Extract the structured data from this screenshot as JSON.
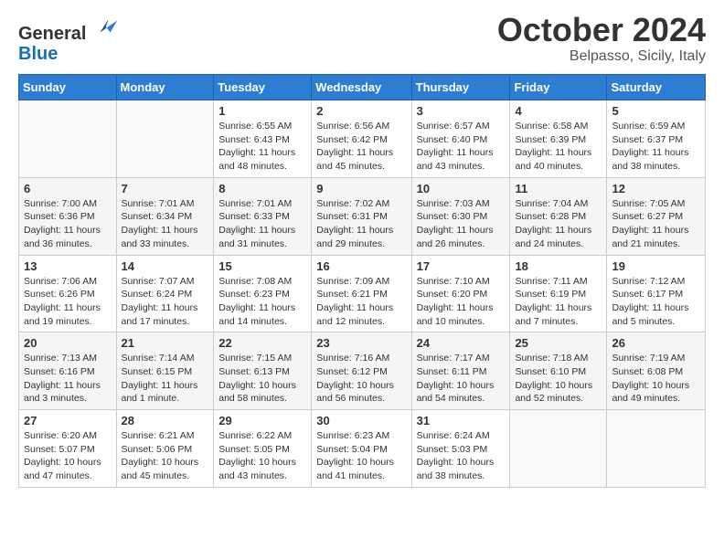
{
  "header": {
    "logo_line1": "General",
    "logo_line2": "Blue",
    "month": "October 2024",
    "location": "Belpasso, Sicily, Italy"
  },
  "days_of_week": [
    "Sunday",
    "Monday",
    "Tuesday",
    "Wednesday",
    "Thursday",
    "Friday",
    "Saturday"
  ],
  "weeks": [
    [
      {
        "day": "",
        "info": ""
      },
      {
        "day": "",
        "info": ""
      },
      {
        "day": "1",
        "info": "Sunrise: 6:55 AM\nSunset: 6:43 PM\nDaylight: 11 hours and 48 minutes."
      },
      {
        "day": "2",
        "info": "Sunrise: 6:56 AM\nSunset: 6:42 PM\nDaylight: 11 hours and 45 minutes."
      },
      {
        "day": "3",
        "info": "Sunrise: 6:57 AM\nSunset: 6:40 PM\nDaylight: 11 hours and 43 minutes."
      },
      {
        "day": "4",
        "info": "Sunrise: 6:58 AM\nSunset: 6:39 PM\nDaylight: 11 hours and 40 minutes."
      },
      {
        "day": "5",
        "info": "Sunrise: 6:59 AM\nSunset: 6:37 PM\nDaylight: 11 hours and 38 minutes."
      }
    ],
    [
      {
        "day": "6",
        "info": "Sunrise: 7:00 AM\nSunset: 6:36 PM\nDaylight: 11 hours and 36 minutes."
      },
      {
        "day": "7",
        "info": "Sunrise: 7:01 AM\nSunset: 6:34 PM\nDaylight: 11 hours and 33 minutes."
      },
      {
        "day": "8",
        "info": "Sunrise: 7:01 AM\nSunset: 6:33 PM\nDaylight: 11 hours and 31 minutes."
      },
      {
        "day": "9",
        "info": "Sunrise: 7:02 AM\nSunset: 6:31 PM\nDaylight: 11 hours and 29 minutes."
      },
      {
        "day": "10",
        "info": "Sunrise: 7:03 AM\nSunset: 6:30 PM\nDaylight: 11 hours and 26 minutes."
      },
      {
        "day": "11",
        "info": "Sunrise: 7:04 AM\nSunset: 6:28 PM\nDaylight: 11 hours and 24 minutes."
      },
      {
        "day": "12",
        "info": "Sunrise: 7:05 AM\nSunset: 6:27 PM\nDaylight: 11 hours and 21 minutes."
      }
    ],
    [
      {
        "day": "13",
        "info": "Sunrise: 7:06 AM\nSunset: 6:26 PM\nDaylight: 11 hours and 19 minutes."
      },
      {
        "day": "14",
        "info": "Sunrise: 7:07 AM\nSunset: 6:24 PM\nDaylight: 11 hours and 17 minutes."
      },
      {
        "day": "15",
        "info": "Sunrise: 7:08 AM\nSunset: 6:23 PM\nDaylight: 11 hours and 14 minutes."
      },
      {
        "day": "16",
        "info": "Sunrise: 7:09 AM\nSunset: 6:21 PM\nDaylight: 11 hours and 12 minutes."
      },
      {
        "day": "17",
        "info": "Sunrise: 7:10 AM\nSunset: 6:20 PM\nDaylight: 11 hours and 10 minutes."
      },
      {
        "day": "18",
        "info": "Sunrise: 7:11 AM\nSunset: 6:19 PM\nDaylight: 11 hours and 7 minutes."
      },
      {
        "day": "19",
        "info": "Sunrise: 7:12 AM\nSunset: 6:17 PM\nDaylight: 11 hours and 5 minutes."
      }
    ],
    [
      {
        "day": "20",
        "info": "Sunrise: 7:13 AM\nSunset: 6:16 PM\nDaylight: 11 hours and 3 minutes."
      },
      {
        "day": "21",
        "info": "Sunrise: 7:14 AM\nSunset: 6:15 PM\nDaylight: 11 hours and 1 minute."
      },
      {
        "day": "22",
        "info": "Sunrise: 7:15 AM\nSunset: 6:13 PM\nDaylight: 10 hours and 58 minutes."
      },
      {
        "day": "23",
        "info": "Sunrise: 7:16 AM\nSunset: 6:12 PM\nDaylight: 10 hours and 56 minutes."
      },
      {
        "day": "24",
        "info": "Sunrise: 7:17 AM\nSunset: 6:11 PM\nDaylight: 10 hours and 54 minutes."
      },
      {
        "day": "25",
        "info": "Sunrise: 7:18 AM\nSunset: 6:10 PM\nDaylight: 10 hours and 52 minutes."
      },
      {
        "day": "26",
        "info": "Sunrise: 7:19 AM\nSunset: 6:08 PM\nDaylight: 10 hours and 49 minutes."
      }
    ],
    [
      {
        "day": "27",
        "info": "Sunrise: 6:20 AM\nSunset: 5:07 PM\nDaylight: 10 hours and 47 minutes."
      },
      {
        "day": "28",
        "info": "Sunrise: 6:21 AM\nSunset: 5:06 PM\nDaylight: 10 hours and 45 minutes."
      },
      {
        "day": "29",
        "info": "Sunrise: 6:22 AM\nSunset: 5:05 PM\nDaylight: 10 hours and 43 minutes."
      },
      {
        "day": "30",
        "info": "Sunrise: 6:23 AM\nSunset: 5:04 PM\nDaylight: 10 hours and 41 minutes."
      },
      {
        "day": "31",
        "info": "Sunrise: 6:24 AM\nSunset: 5:03 PM\nDaylight: 10 hours and 38 minutes."
      },
      {
        "day": "",
        "info": ""
      },
      {
        "day": "",
        "info": ""
      }
    ]
  ]
}
